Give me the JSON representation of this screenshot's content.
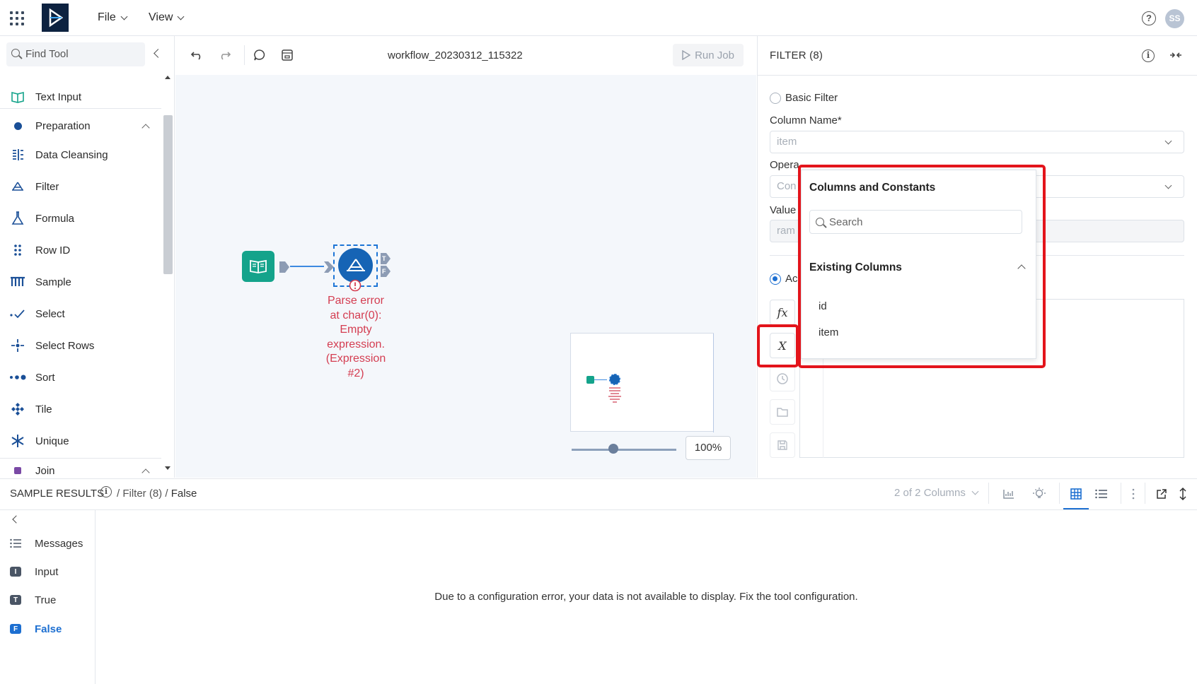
{
  "topbar": {
    "menus": [
      "File",
      "View"
    ],
    "help": "?",
    "avatar_initials": "SS"
  },
  "left_panel": {
    "search_placeholder": "Find Tool",
    "tools": [
      {
        "label": "Text Input",
        "icon": "book-icon"
      },
      {
        "label": "Preparation",
        "icon": "category-dot-icon",
        "category": true
      },
      {
        "label": "Data Cleansing",
        "icon": "data-cleansing-icon"
      },
      {
        "label": "Filter",
        "icon": "filter-icon"
      },
      {
        "label": "Formula",
        "icon": "flask-icon"
      },
      {
        "label": "Row ID",
        "icon": "row-id-icon"
      },
      {
        "label": "Sample",
        "icon": "sample-icon"
      },
      {
        "label": "Select",
        "icon": "select-icon"
      },
      {
        "label": "Select Rows",
        "icon": "select-rows-icon"
      },
      {
        "label": "Sort",
        "icon": "sort-icon"
      },
      {
        "label": "Tile",
        "icon": "tile-icon"
      },
      {
        "label": "Unique",
        "icon": "unique-icon"
      },
      {
        "label": "Join",
        "icon": "category-square-icon",
        "category": true
      }
    ]
  },
  "canvas": {
    "workflow_name": "workflow_20230312_115322",
    "run_job": "Run Job",
    "error_text": "Parse error at char(0): Empty expression. (Expression #2)",
    "error_lines": [
      "Parse error",
      "at char(0):",
      "Empty",
      "expression.",
      "(Expression",
      "#2)"
    ],
    "zoom": "100%",
    "zoom_level": 0.4,
    "anchors": {
      "true": "T",
      "false": "F"
    }
  },
  "right_panel": {
    "title": "FILTER (8)",
    "basic_filter": "Basic Filter",
    "column_name_label": "Column Name*",
    "column_name_value": "item",
    "operator_label": "Opera",
    "operator_value": "Con",
    "value_label": "Value",
    "value_value": "ram",
    "advanced_label": "Ac",
    "side_buttons": [
      "fx",
      "X"
    ]
  },
  "popup": {
    "title": "Columns and Constants",
    "search_placeholder": "Search",
    "section": "Existing Columns",
    "columns": [
      "id",
      "item"
    ]
  },
  "bottom": {
    "title": "SAMPLE RESULTS",
    "crumbs": [
      "Filter (8)",
      "False"
    ],
    "columns_selector": "2 of 2 Columns",
    "items": [
      {
        "label": "Messages",
        "badge": ""
      },
      {
        "label": "Input",
        "badge": "I"
      },
      {
        "label": "True",
        "badge": "T"
      },
      {
        "label": "False",
        "badge": "F"
      }
    ],
    "message": "Due to a configuration error, your data is not available to display. Fix the tool configuration."
  },
  "colors": {
    "accent": "#1d6fd1",
    "error": "#d43d51",
    "highlight": "#e3141b",
    "text_input_node": "#14a38b",
    "filter_node": "#1664b5"
  }
}
